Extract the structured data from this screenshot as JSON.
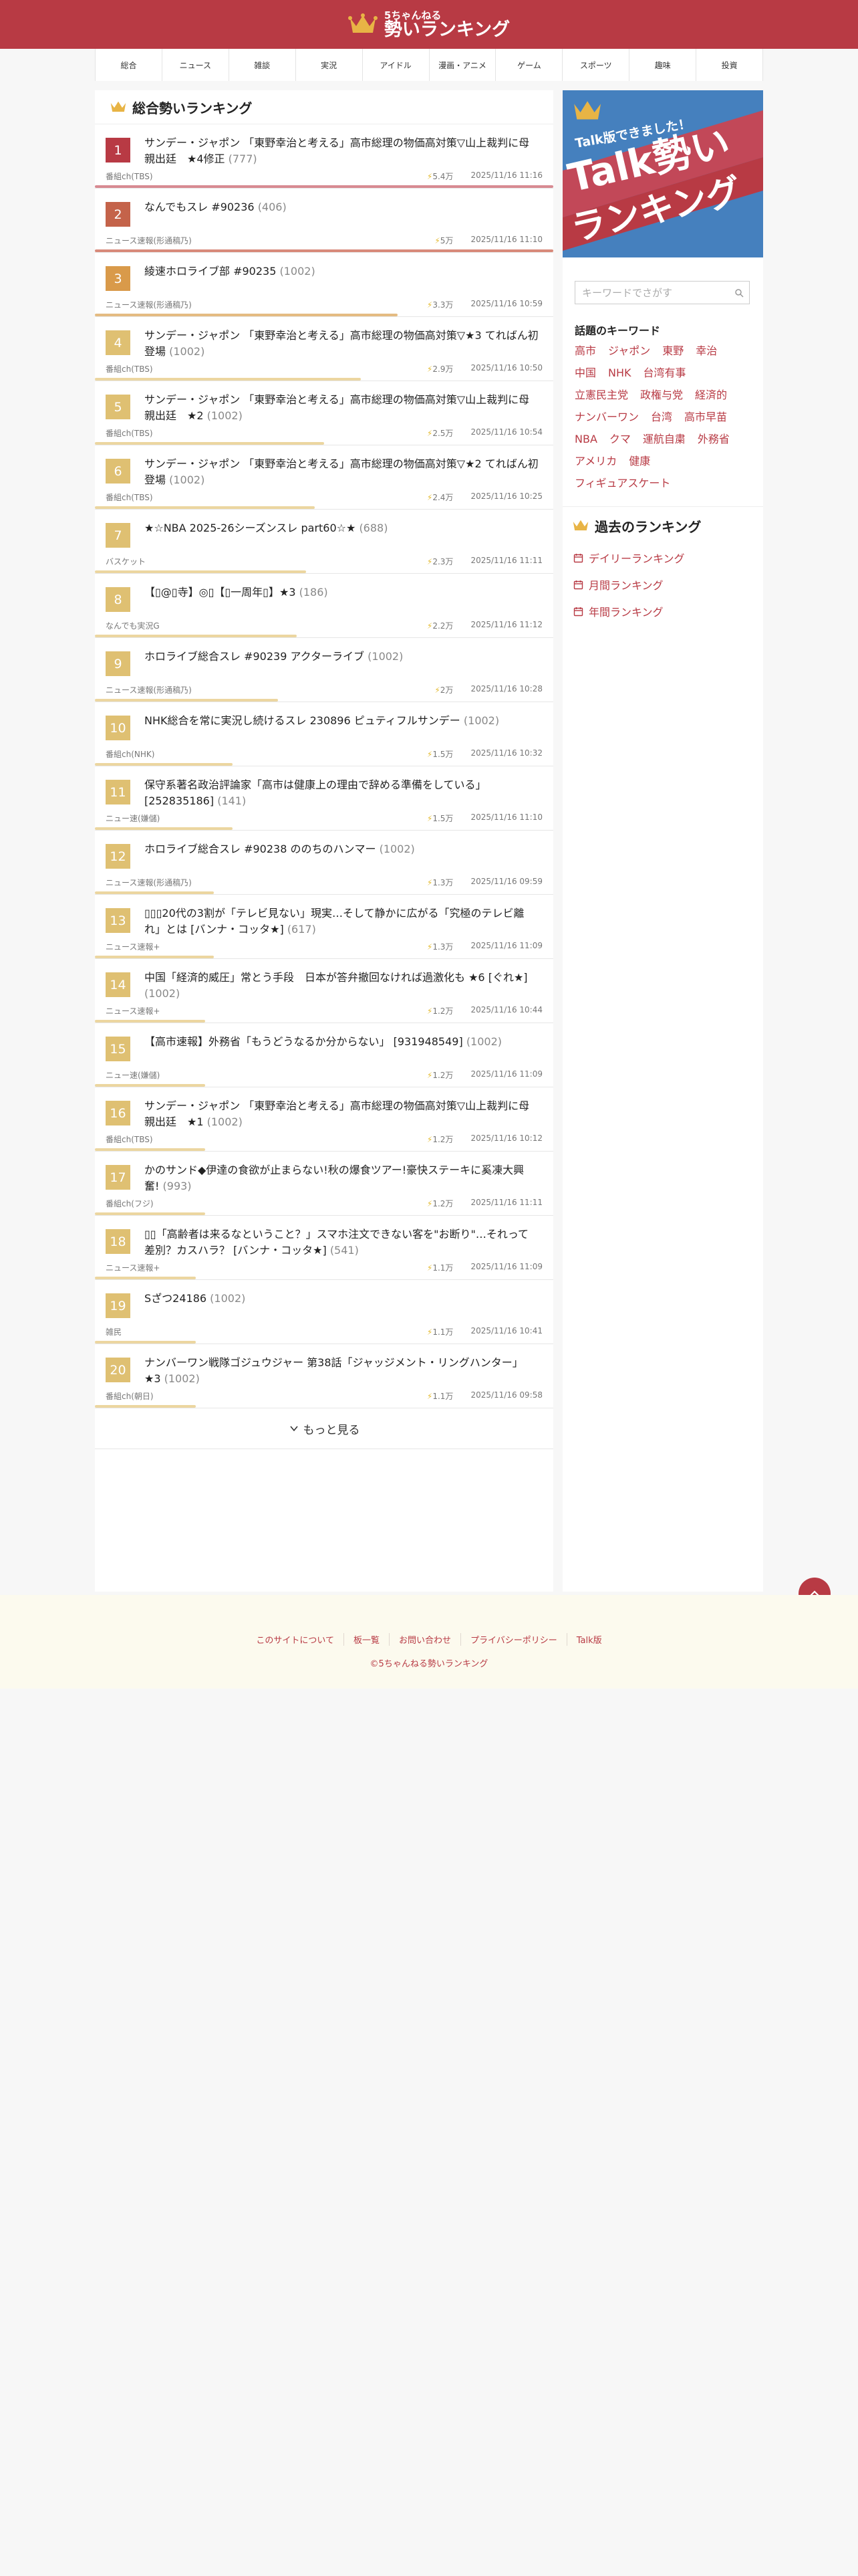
{
  "site": {
    "logo_sub": "5ちゃんねる",
    "logo_main": "勢いランキング"
  },
  "nav": [
    "総合",
    "ニュース",
    "雑談",
    "実況",
    "アイドル",
    "漫画・アニメ",
    "ゲーム",
    "スポーツ",
    "趣味",
    "投資"
  ],
  "ranking": {
    "heading": "総合勢いランキング",
    "more_label": "もっと見る",
    "items": [
      {
        "rank": "1",
        "title": "サンデー・ジャポン 「東野幸治と考える」高市総理の物価高対策▽山上裁判に母親出廷　★4修正",
        "count": "(777)",
        "board": "番組ch(TBS)",
        "speed": "5.4万",
        "date": "2025/11/16 11:16",
        "badge_color": "#b83a44",
        "bar_color": "#d88a92",
        "bar_frac": 1.0
      },
      {
        "rank": "2",
        "title": "なんでもスレ #90236",
        "count": "(406)",
        "board": "ニュース速報(形通稿乃)",
        "speed": "5万",
        "date": "2025/11/16 11:10",
        "badge_color": "#c4634a",
        "bar_color": "#d88a7a",
        "bar_frac": 1.0
      },
      {
        "rank": "3",
        "title": "綾速ホロライブ部 #90235",
        "count": "(1002)",
        "board": "ニュース速報(形通稿乃)",
        "speed": "3.3万",
        "date": "2025/11/16 10:59",
        "badge_color": "#d99a4a",
        "bar_color": "#e4bb82",
        "bar_frac": 0.66
      },
      {
        "rank": "4",
        "title": "サンデー・ジャポン 「東野幸治と考える」高市総理の物価高対策▽★3 てればん初登場",
        "count": "(1002)",
        "board": "番組ch(TBS)",
        "speed": "2.9万",
        "date": "2025/11/16 10:50",
        "badge_color": "#dfc072",
        "bar_color": "#ecd6a0",
        "bar_frac": 0.58
      },
      {
        "rank": "5",
        "title": "サンデー・ジャポン 「東野幸治と考える」高市総理の物価高対策▽山上裁判に母親出廷　★2",
        "count": "(1002)",
        "board": "番組ch(TBS)",
        "speed": "2.5万",
        "date": "2025/11/16 10:54",
        "badge_color": "#dfc072",
        "bar_color": "#ecd6a0",
        "bar_frac": 0.5
      },
      {
        "rank": "6",
        "title": "サンデー・ジャポン 「東野幸治と考える」高市総理の物価高対策▽★2 てればん初登場",
        "count": "(1002)",
        "board": "番組ch(TBS)",
        "speed": "2.4万",
        "date": "2025/11/16 10:25",
        "badge_color": "#dfc072",
        "bar_color": "#ecd6a0",
        "bar_frac": 0.48
      },
      {
        "rank": "7",
        "title": "★☆NBA 2025-26シーズンスレ part60☆★",
        "count": "(688)",
        "board": "バスケット",
        "speed": "2.3万",
        "date": "2025/11/16 11:11",
        "badge_color": "#dfc072",
        "bar_color": "#ecd6a0",
        "bar_frac": 0.46
      },
      {
        "rank": "8",
        "title": "【▯@▯寺】◎▯【▯一周年▯】★3",
        "count": "(186)",
        "board": "なんでも実況G",
        "speed": "2.2万",
        "date": "2025/11/16 11:12",
        "badge_color": "#dfc072",
        "bar_color": "#ecd6a0",
        "bar_frac": 0.44
      },
      {
        "rank": "9",
        "title": "ホロライブ総合スレ #90239 アクターライブ",
        "count": "(1002)",
        "board": "ニュース速報(形通稿乃)",
        "speed": "2万",
        "date": "2025/11/16 10:28",
        "badge_color": "#dfc072",
        "bar_color": "#ecd6a0",
        "bar_frac": 0.4
      },
      {
        "rank": "10",
        "title": "NHK総合を常に実況し続けるスレ 230896 ピュティフルサンデー",
        "count": "(1002)",
        "board": "番組ch(NHK)",
        "speed": "1.5万",
        "date": "2025/11/16 10:32",
        "badge_color": "#dfc072",
        "bar_color": "#ecd6a0",
        "bar_frac": 0.3
      },
      {
        "rank": "11",
        "title": "保守系著名政治評論家「高市は健康上の理由で辞める準備をしている」 [252835186]",
        "count": "(141)",
        "board": "ニュー速(嫌儲)",
        "speed": "1.5万",
        "date": "2025/11/16 11:10",
        "badge_color": "#dfc072",
        "bar_color": "#ecd6a0",
        "bar_frac": 0.3
      },
      {
        "rank": "12",
        "title": "ホロライブ総合スレ #90238 ののちのハンマー",
        "count": "(1002)",
        "board": "ニュース速報(形通稿乃)",
        "speed": "1.3万",
        "date": "2025/11/16 09:59",
        "badge_color": "#dfc072",
        "bar_color": "#ecd6a0",
        "bar_frac": 0.26
      },
      {
        "rank": "13",
        "title": "▯▯▯20代の3割が「テレビ見ない」現実…そして静かに広がる「究極のテレビ離れ」とは [バンナ・コッタ★]",
        "count": "(617)",
        "board": "ニュース速報+",
        "speed": "1.3万",
        "date": "2025/11/16 11:09",
        "badge_color": "#dfc072",
        "bar_color": "#ecd6a0",
        "bar_frac": 0.26
      },
      {
        "rank": "14",
        "title": "中国「経済的威圧」常とう手段　日本が答弁撤回なければ過激化も ★6 [ぐれ★]",
        "count": "(1002)",
        "board": "ニュース速報+",
        "speed": "1.2万",
        "date": "2025/11/16 10:44",
        "badge_color": "#dfc072",
        "bar_color": "#ecd6a0",
        "bar_frac": 0.24
      },
      {
        "rank": "15",
        "title": "【高市速報】外務省「もうどうなるか分からない」 [931948549]",
        "count": "(1002)",
        "board": "ニュー速(嫌儲)",
        "speed": "1.2万",
        "date": "2025/11/16 11:09",
        "badge_color": "#dfc072",
        "bar_color": "#ecd6a0",
        "bar_frac": 0.24
      },
      {
        "rank": "16",
        "title": "サンデー・ジャポン 「東野幸治と考える」高市総理の物価高対策▽山上裁判に母親出廷　★1",
        "count": "(1002)",
        "board": "番組ch(TBS)",
        "speed": "1.2万",
        "date": "2025/11/16 10:12",
        "badge_color": "#dfc072",
        "bar_color": "#ecd6a0",
        "bar_frac": 0.24
      },
      {
        "rank": "17",
        "title": "かのサンド◆伊達の食欲が止まらない!秋の爆食ツアー!豪快ステーキに奚凍大興奮!",
        "count": "(993)",
        "board": "番組ch(フジ)",
        "speed": "1.2万",
        "date": "2025/11/16 11:11",
        "badge_color": "#dfc072",
        "bar_color": "#ecd6a0",
        "bar_frac": 0.24
      },
      {
        "rank": "18",
        "title": "▯▯「高齢者は来るなということ？」スマホ注文できない客を\"お断り\"…それって差別？カスハラ？ [バンナ・コッタ★]",
        "count": "(541)",
        "board": "ニュース速報+",
        "speed": "1.1万",
        "date": "2025/11/16 11:09",
        "badge_color": "#dfc072",
        "bar_color": "#ecd6a0",
        "bar_frac": 0.22
      },
      {
        "rank": "19",
        "title": "Sざつ24186",
        "count": "(1002)",
        "board": "雑民",
        "speed": "1.1万",
        "date": "2025/11/16 10:41",
        "badge_color": "#dfc072",
        "bar_color": "#ecd6a0",
        "bar_frac": 0.22
      },
      {
        "rank": "20",
        "title": "ナンバーワン戦隊ゴジュウジャー 第38話「ジャッジメント・リングハンター」★3",
        "count": "(1002)",
        "board": "番組ch(朝日)",
        "speed": "1.1万",
        "date": "2025/11/16 09:58",
        "badge_color": "#dfc072",
        "bar_color": "#ecd6a0",
        "bar_frac": 0.22
      }
    ]
  },
  "sidebar": {
    "banner_line1": "Talk版できました！",
    "banner_line2": "Talk勢い",
    "banner_line3": "ランキング",
    "search_placeholder": "キーワードでさがす",
    "keywords_heading": "話題のキーワード",
    "keywords": [
      "高市",
      "ジャポン",
      "東野",
      "幸治",
      "中国",
      "NHK",
      "台湾有事",
      "立憲民主党",
      "政権与党",
      "経済的",
      "ナンバーワン",
      "台湾",
      "高市早苗",
      "NBA",
      "クマ",
      "運航自粛",
      "外務省",
      "アメリカ",
      "健康",
      "フィギュアスケート"
    ],
    "past_heading": "過去のランキング",
    "past_links": [
      "デイリーランキング",
      "月間ランキング",
      "年間ランキング"
    ]
  },
  "footer": {
    "links": [
      "このサイトについて",
      "板一覧",
      "お問い合わせ",
      "プライバシーポリシー",
      "Talk版"
    ],
    "copyright": "©5ちゃんねる勢いランキング"
  },
  "colors": {
    "brand": "#b83a44",
    "footer_bg": "#fcfaee"
  },
  "icons": {
    "crown": "crown-icon",
    "speed": "bolt-icon",
    "calendar": "calendar-icon",
    "search": "search-icon",
    "more": "chevron-down-icon",
    "to_top": "chevron-up-icon"
  }
}
